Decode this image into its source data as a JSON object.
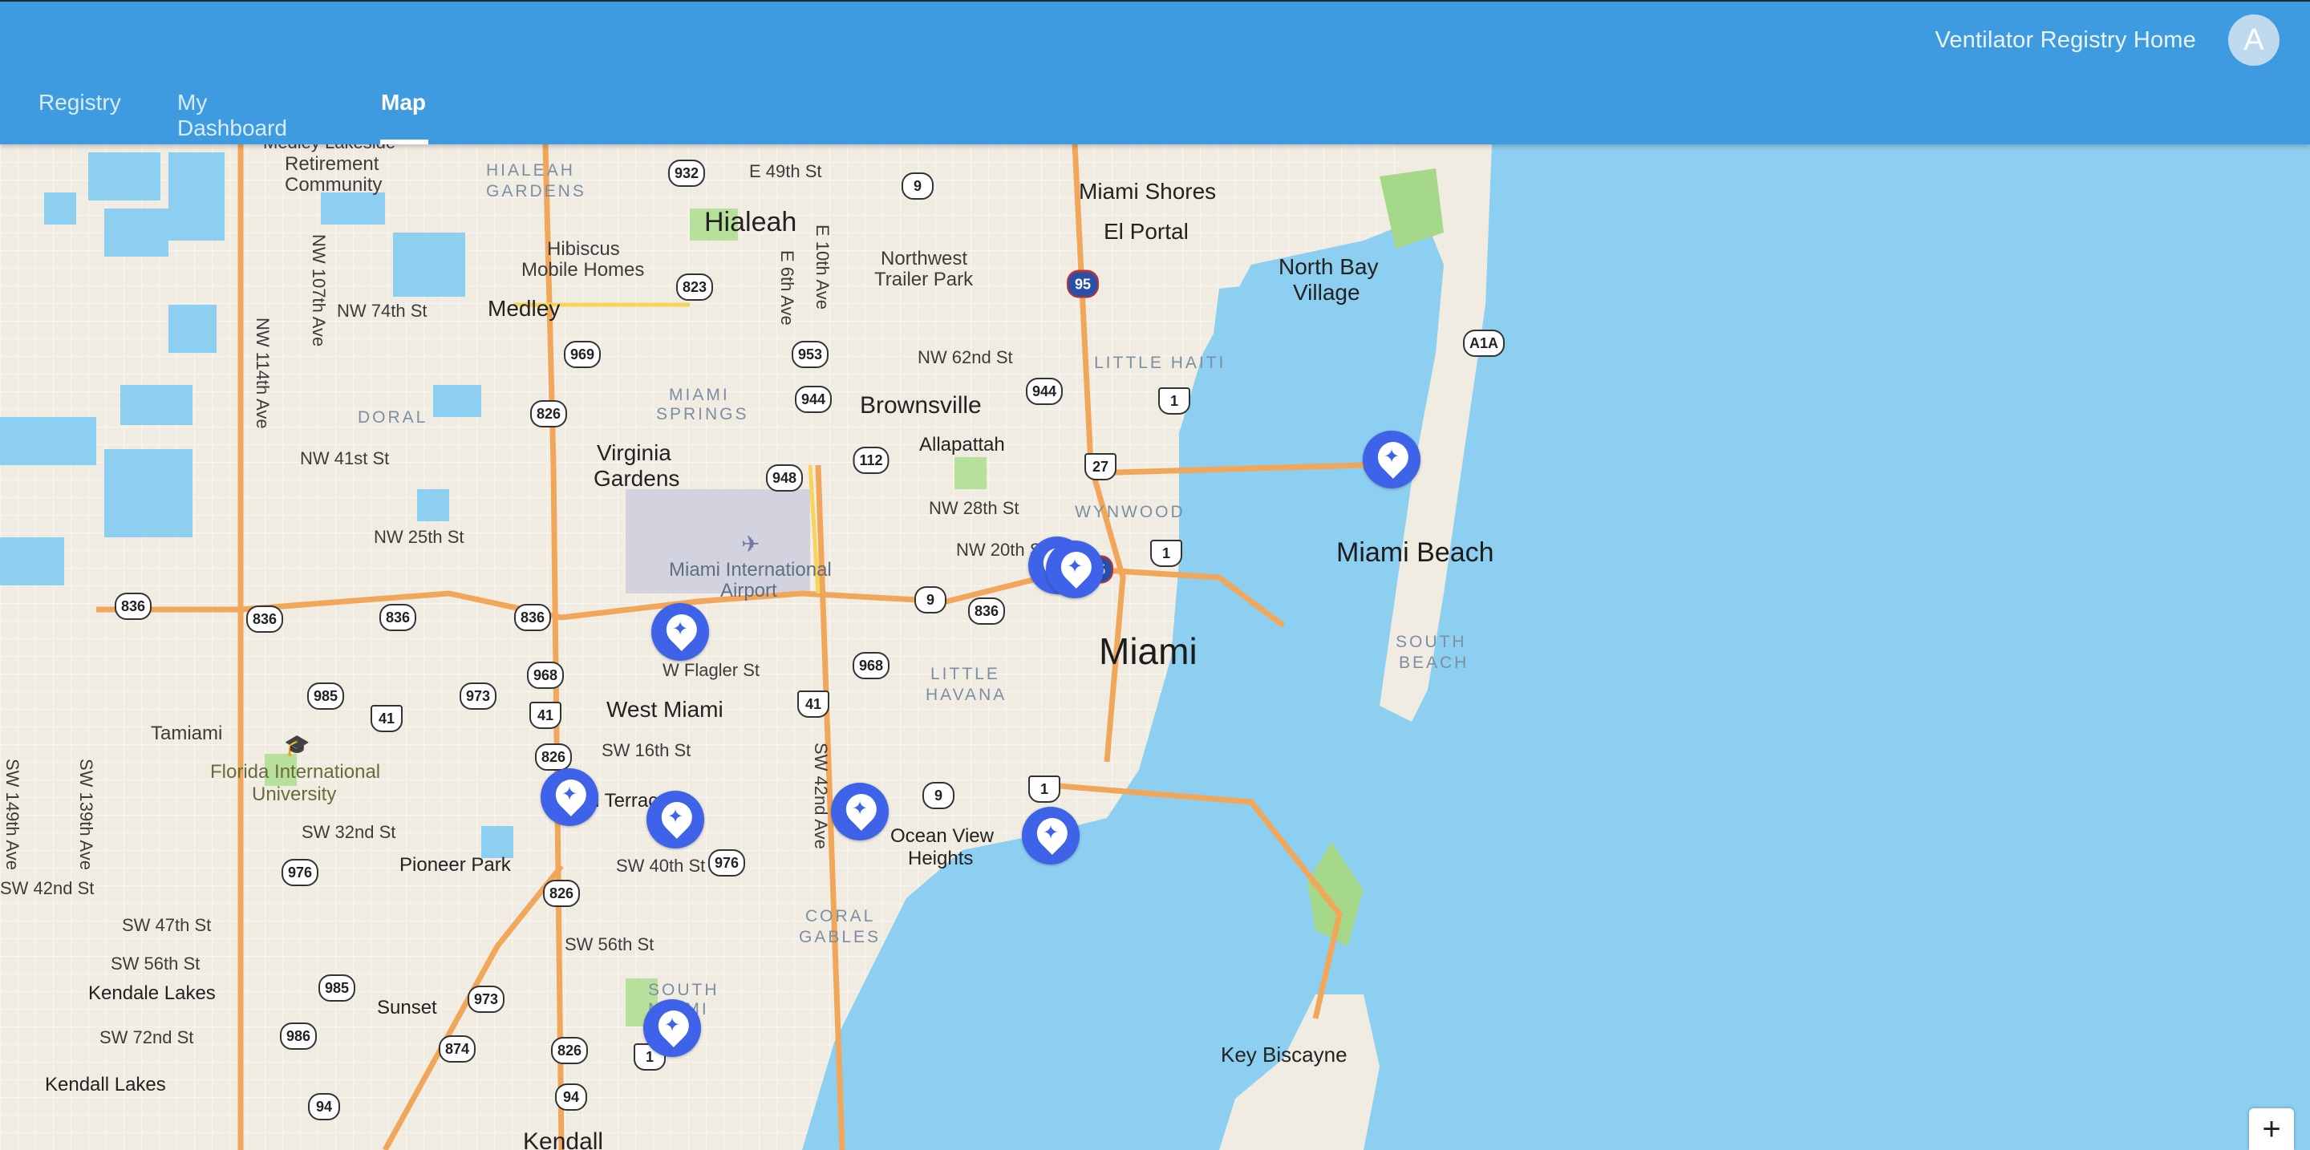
{
  "header": {
    "home_link": "Ventilator Registry Home",
    "avatar_initial": "A",
    "tabs": [
      {
        "label": "Registry",
        "active": false
      },
      {
        "label": "My Dashboard",
        "active": false
      },
      {
        "label": "Map",
        "active": true
      }
    ],
    "colors": {
      "bar": "#3e9be0",
      "marker": "#3f63e8",
      "water": "#8ccff0"
    }
  },
  "map": {
    "labels": {
      "medley_lakeside": "Medley Lakeside",
      "retirement": "Retirement",
      "community": "Community",
      "hialeah_gardens": "HIALEAH",
      "hialeah_gardens2": "GARDENS",
      "hialeah": "Hialeah",
      "hibiscus": "Hibiscus",
      "mobile_homes": "Mobile Homes",
      "medley": "Medley",
      "northwest": "Northwest",
      "trailer_park": "Trailer Park",
      "miami_shores": "Miami Shores",
      "el_portal": "El Portal",
      "north_bay": "North Bay",
      "village": "Village",
      "little_haiti": "LITTLE HAITI",
      "miami_springs": "MIAMI",
      "miami_springs2": "SPRINGS",
      "brownsville": "Brownsville",
      "doral": "DORAL",
      "virginia": "Virginia",
      "gardens": "Gardens",
      "allapattah": "Allapattah",
      "wynwood": "WYNWOOD",
      "miami_intl": "Miami International",
      "airport": "Airport",
      "miami_beach": "Miami Beach",
      "miami": "Miami",
      "south_beach": "SOUTH",
      "south_beach2": "BEACH",
      "little_havana": "LITTLE",
      "little_havana2": "HAVANA",
      "west_miami": "West Miami",
      "tamiami": "Tamiami",
      "fiu": "Florida International",
      "fiu2": "University",
      "coral_terrace": "Coral Terrace",
      "pioneer_park": "Pioneer Park",
      "ocean_view": "Ocean View",
      "heights": "Heights",
      "coral_gables": "CORAL",
      "coral_gables2": "GABLES",
      "south_miami": "SOUTH",
      "south_miami2": "MIAMI",
      "kendale_lakes": "Kendale Lakes",
      "sunset": "Sunset",
      "kendall_lakes": "Kendall Lakes",
      "key_biscayne": "Key Biscayne",
      "kendall": "Kendall"
    },
    "streets": {
      "e49": "E 49th St",
      "nw74": "NW 74th St",
      "nw41": "NW 41st St",
      "nw25": "NW 25th St",
      "nw62": "NW 62nd St",
      "nw28": "NW 28th St",
      "nw20": "NW 20th St",
      "wflagler": "W Flagler St",
      "sw16": "SW 16th St",
      "sw32": "SW 32nd St",
      "sw40": "SW 40th St",
      "sw42": "SW 42nd St",
      "sw47": "SW 47th St",
      "sw56a": "SW 56th St",
      "sw56b": "SW 56th St",
      "sw72": "SW 72nd St",
      "nw107": "NW 107th Ave",
      "nw114": "NW 114th Ave",
      "e10": "E 10th Ave",
      "e6": "E 6th Ave",
      "sw42ave": "SW 42nd Ave",
      "sw139": "SW 139th Ave",
      "sw149": "SW 149th Ave"
    },
    "shields": [
      "932",
      "9",
      "823",
      "969",
      "953",
      "944",
      "944",
      "826",
      "948",
      "112",
      "27",
      "1",
      "1",
      "836",
      "836",
      "836",
      "836",
      "836",
      "9",
      "968",
      "985",
      "973",
      "41",
      "968",
      "41",
      "41",
      "826",
      "9",
      "1",
      "976",
      "976",
      "826",
      "985",
      "973",
      "986",
      "874",
      "826",
      "1",
      "94",
      "94",
      "95",
      "A1A",
      "95",
      "95"
    ],
    "markers_count": 10,
    "zoom_in": "+"
  }
}
